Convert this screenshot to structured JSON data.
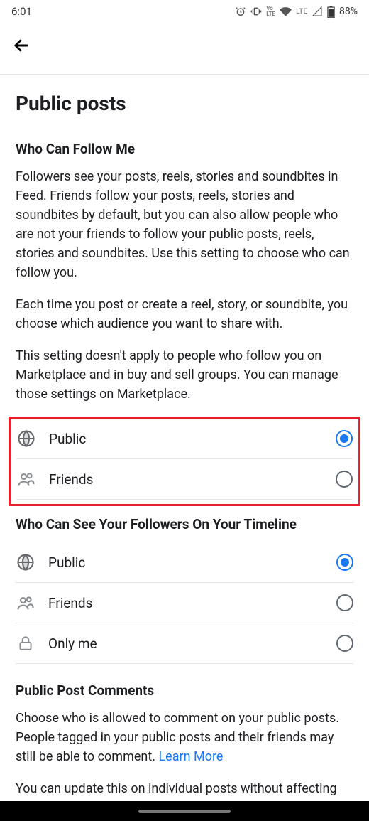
{
  "status": {
    "time": "6:01",
    "lte": "LTE",
    "battery": "88%"
  },
  "page": {
    "title": "Public posts"
  },
  "section_follow": {
    "title": "Who Can Follow Me",
    "para1": "Followers see your posts, reels, stories and soundbites in Feed. Friends follow your posts, reels, stories and soundbites by default, but you can also allow people who are not your friends to follow your public posts, reels, stories and soundbites. Use this setting to choose who can follow you.",
    "para2": "Each time you post or create a reel, story, or soundbite, you choose which audience you want to share with.",
    "para3": "This setting doesn't apply to people who follow you on Marketplace and in buy and sell groups. You can manage those settings on Marketplace.",
    "options": [
      {
        "label": "Public",
        "selected": true,
        "icon": "globe"
      },
      {
        "label": "Friends",
        "selected": false,
        "icon": "friends"
      }
    ]
  },
  "section_followers": {
    "title": "Who Can See Your Followers On Your Timeline",
    "options": [
      {
        "label": "Public",
        "selected": true,
        "icon": "globe"
      },
      {
        "label": "Friends",
        "selected": false,
        "icon": "friends"
      },
      {
        "label": "Only me",
        "selected": false,
        "icon": "lock"
      }
    ]
  },
  "section_comments": {
    "title": "Public Post Comments",
    "para1_a": "Choose who is allowed to comment on your public posts. People tagged in your public posts and their friends may still be able to comment. ",
    "learn_more": "Learn More",
    "para2": "You can update this on individual posts without affecting your account settings."
  }
}
